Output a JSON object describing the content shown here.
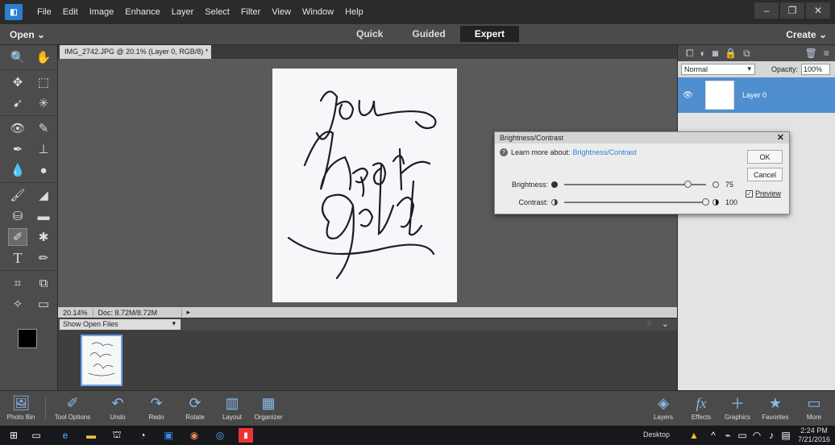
{
  "menubar": {
    "items": [
      "File",
      "Edit",
      "Image",
      "Enhance",
      "Layer",
      "Select",
      "Filter",
      "View",
      "Window",
      "Help"
    ]
  },
  "modebar": {
    "open_label": "Open",
    "modes": [
      "Quick",
      "Guided",
      "Expert"
    ],
    "active_mode": "Expert",
    "create_label": "Create"
  },
  "document": {
    "tab_title": "IMG_2742.JPG @ 20.1% (Layer 0, RGB/8) *",
    "zoom": "20.14%",
    "doc_info": "Doc: 8.72M/8.72M",
    "lettering": "You have a heart of Gold"
  },
  "photo_bin": {
    "show_label": "Show Open Files"
  },
  "layers": {
    "blend_mode": "Normal",
    "opacity_label": "Opacity:",
    "opacity_value": "100%",
    "layer_name": "Layer 0"
  },
  "dialog": {
    "title": "Brightness/Contrast",
    "learn_prefix": "Learn more about:",
    "learn_link": "Brightness/Contrast",
    "brightness_label": "Brightness:",
    "brightness_value": "75",
    "brightness_fraction": 0.875,
    "contrast_label": "Contrast:",
    "contrast_value": "100",
    "contrast_fraction": 1.0,
    "ok_label": "OK",
    "cancel_label": "Cancel",
    "preview_label": "Preview",
    "preview_checked": true
  },
  "bottombar": {
    "left": [
      "Photo Bin",
      "Tool Options",
      "Undo",
      "Redo",
      "Rotate",
      "Layout",
      "Organizer"
    ],
    "right": [
      "Layers",
      "Effects",
      "Graphics",
      "Favorites",
      "More"
    ]
  },
  "taskbar": {
    "desktop_label": "Desktop",
    "time": "2:24 PM",
    "date": "7/21/2016"
  },
  "colors": {
    "accent": "#4f8fcf",
    "link": "#2b7fd6"
  }
}
